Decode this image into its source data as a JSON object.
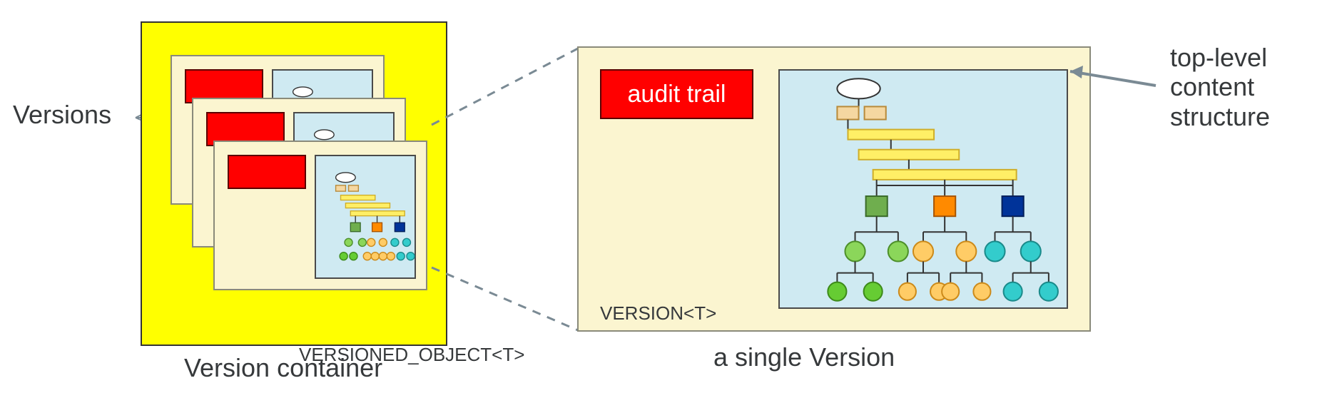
{
  "labels": {
    "versions": "Versions",
    "version_container": "Version container",
    "single_version": "a single Version",
    "top_level": "top-level\ncontent\nstructure",
    "versioned_object_t": "VERSIONED_OBJECT<T>",
    "version_t": "VERSION<T>",
    "audit_trail": "audit trail"
  },
  "colors": {
    "container_bg": "#ffff00",
    "card_bg": "#fbf5d0",
    "red": "#ff0000",
    "blue_panel": "#cfeaf2",
    "tree_green": "#66cc33",
    "tree_orange": "#ff8a00",
    "tree_peach": "#ffcc66",
    "tree_cyan": "#33cccc",
    "tree_blue": "#003399",
    "tree_yellow": "#ffef66"
  }
}
